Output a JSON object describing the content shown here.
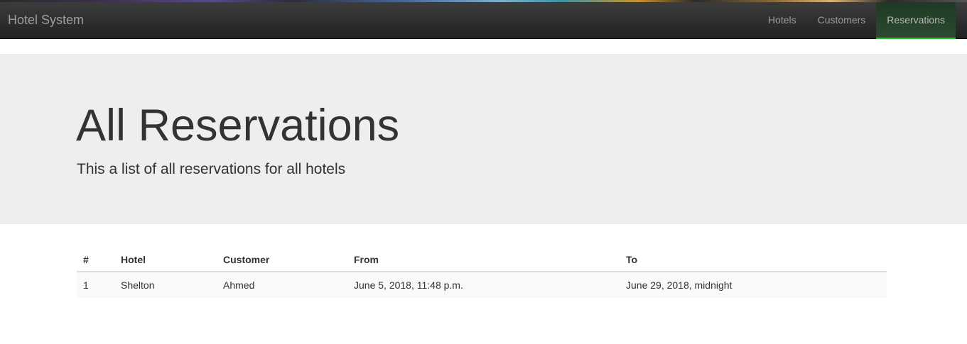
{
  "navbar": {
    "brand": "Hotel System",
    "items": [
      {
        "label": "Hotels",
        "active": false
      },
      {
        "label": "Customers",
        "active": false
      },
      {
        "label": "Reservations",
        "active": true
      }
    ],
    "accent_color": "#20c030"
  },
  "jumbotron": {
    "title": "All Reservations",
    "subtitle": "This a list of all reservations for all hotels"
  },
  "table": {
    "headers": [
      "#",
      "Hotel",
      "Customer",
      "From",
      "To"
    ],
    "rows": [
      [
        "1",
        "Shelton",
        "Ahmed",
        "June 5, 2018, 11:48 p.m.",
        "June 29, 2018, midnight"
      ]
    ]
  }
}
